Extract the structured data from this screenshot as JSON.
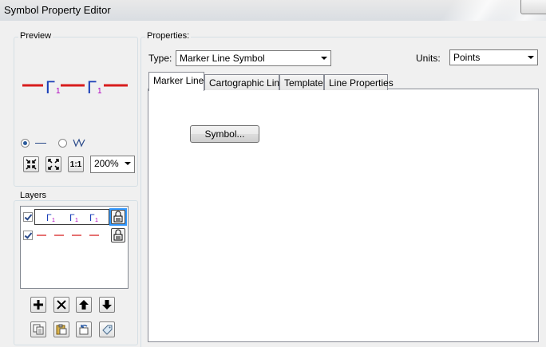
{
  "window": {
    "title": "Symbol Property Editor"
  },
  "preview": {
    "label": "Preview",
    "symbol_glyph": "Γ",
    "symbol_sub": "1",
    "zoom": {
      "value": "200%",
      "options": [
        "200%"
      ]
    }
  },
  "layers": {
    "label": "Layers",
    "rows": [
      {
        "glyph": "Γ",
        "sub": "1",
        "checked": true,
        "selected": true
      },
      {
        "checked": true,
        "selected": false
      }
    ]
  },
  "properties": {
    "label": "Properties:",
    "type_label": "Type:",
    "type_value": "Marker Line Symbol",
    "units_label": "Units:",
    "units_value": "Points",
    "tabs": [
      {
        "label": "Marker Line",
        "active": true
      },
      {
        "label": "Cartographic Line",
        "active": false
      },
      {
        "label": "Template",
        "active": false
      },
      {
        "label": "Line Properties",
        "active": false
      }
    ],
    "symbol_button_label": "Symbol..."
  },
  "colors": {
    "line_red": "#d81c1c",
    "glyph_blue": "#1a3fb8",
    "glyph_magenta": "#b000c0",
    "selection_blue": "#3399ff"
  }
}
